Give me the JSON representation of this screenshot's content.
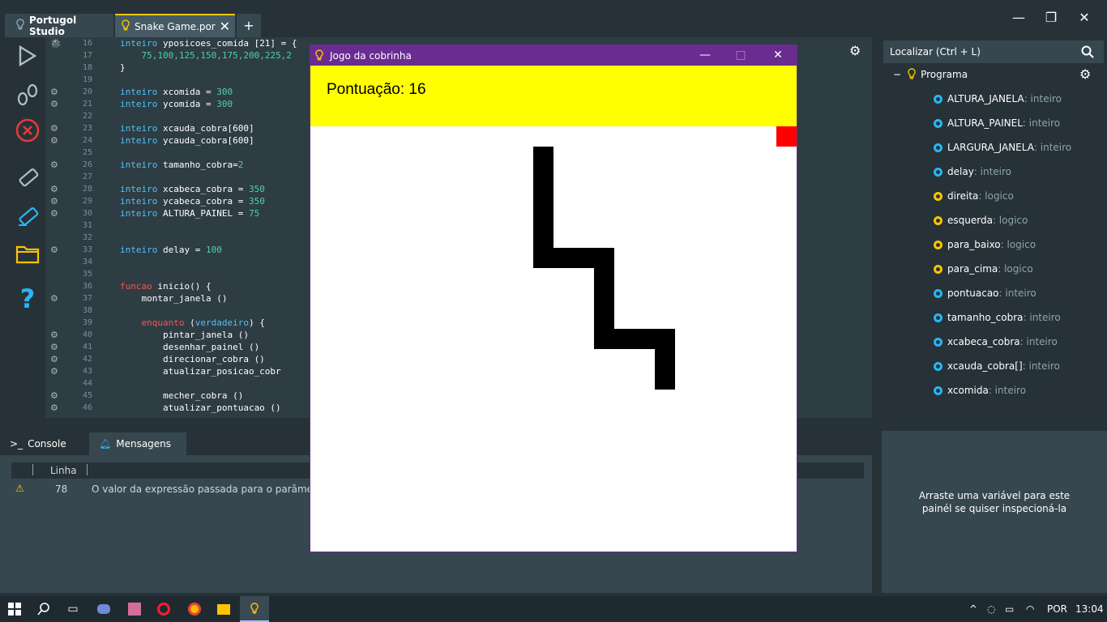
{
  "tabs": {
    "home": "Portugol Studio",
    "file": "Snake Game.por",
    "add": "+"
  },
  "window": {
    "minimize": "—",
    "maximize": "❐",
    "close": "✕"
  },
  "editor": {
    "lines": [
      {
        "n": "16",
        "code": [
          "inteiro yposicoes_comida [21] = {"
        ]
      },
      {
        "n": "17",
        "code": [
          "    75,100,125,150,175,200,225,2"
        ]
      },
      {
        "n": "18",
        "code": [
          "}"
        ]
      },
      {
        "n": "19",
        "code": [
          ""
        ]
      },
      {
        "n": "20",
        "code": [
          "inteiro xcomida = 300"
        ]
      },
      {
        "n": "21",
        "code": [
          "inteiro ycomida = 300"
        ]
      },
      {
        "n": "22",
        "code": [
          ""
        ]
      },
      {
        "n": "23",
        "code": [
          "inteiro xcauda_cobra[600]"
        ]
      },
      {
        "n": "24",
        "code": [
          "inteiro ycauda_cobra[600]"
        ]
      },
      {
        "n": "25",
        "code": [
          ""
        ]
      },
      {
        "n": "26",
        "code": [
          "inteiro tamanho_cobra=2"
        ]
      },
      {
        "n": "27",
        "code": [
          ""
        ]
      },
      {
        "n": "28",
        "code": [
          "inteiro xcabeca_cobra = 350"
        ]
      },
      {
        "n": "29",
        "code": [
          "inteiro ycabeca_cobra = 350"
        ]
      },
      {
        "n": "30",
        "code": [
          "inteiro ALTURA_PAINEL = 75"
        ]
      },
      {
        "n": "31",
        "code": [
          ""
        ]
      },
      {
        "n": "32",
        "code": [
          ""
        ]
      },
      {
        "n": "33",
        "code": [
          "inteiro delay = 100"
        ]
      },
      {
        "n": "34",
        "code": [
          ""
        ]
      },
      {
        "n": "35",
        "code": [
          ""
        ]
      },
      {
        "n": "36",
        "code": [
          "funcao inicio() {"
        ]
      },
      {
        "n": "37",
        "code": [
          "    montar_janela ()"
        ]
      },
      {
        "n": "38",
        "code": [
          ""
        ]
      },
      {
        "n": "39",
        "code": [
          "    enquanto (verdadeiro) {"
        ]
      },
      {
        "n": "40",
        "code": [
          "        pintar_janela ()"
        ]
      },
      {
        "n": "41",
        "code": [
          "        desenhar_painel ()"
        ]
      },
      {
        "n": "42",
        "code": [
          "        direcionar_cobra ()"
        ]
      },
      {
        "n": "43",
        "code": [
          "        atualizar_posicao_cobr"
        ]
      },
      {
        "n": "44",
        "code": [
          ""
        ]
      },
      {
        "n": "45",
        "code": [
          "        mecher_cobra ()"
        ]
      },
      {
        "n": "46",
        "code": [
          "        atualizar_pontuacao ()"
        ]
      }
    ]
  },
  "bottom": {
    "console_tab": "Console",
    "messages_tab": "Mensagens",
    "col_line": "Linha",
    "row_line": "78",
    "row_message": "O valor da expressão passada para o parâmetro \"t"
  },
  "right": {
    "search_placeholder": "Localizar (Ctrl + L)",
    "root": "Programa",
    "items": [
      {
        "name": "ALTURA_JANELA",
        "type": " : inteiro",
        "color": "blue"
      },
      {
        "name": "ALTURA_PAINEL",
        "type": " : inteiro",
        "color": "blue"
      },
      {
        "name": "LARGURA_JANELA",
        "type": " : inteiro",
        "color": "blue"
      },
      {
        "name": "delay",
        "type": " : inteiro",
        "color": "blue"
      },
      {
        "name": "direita",
        "type": " : logico",
        "color": "yellow"
      },
      {
        "name": "esquerda",
        "type": " : logico",
        "color": "yellow"
      },
      {
        "name": "para_baixo",
        "type": " : logico",
        "color": "yellow"
      },
      {
        "name": "para_cima",
        "type": " : logico",
        "color": "yellow"
      },
      {
        "name": "pontuacao",
        "type": " : inteiro",
        "color": "blue"
      },
      {
        "name": "tamanho_cobra",
        "type": " : inteiro",
        "color": "blue"
      },
      {
        "name": "xcabeca_cobra",
        "type": " : inteiro",
        "color": "blue"
      },
      {
        "name": "xcauda_cobra[]",
        "type": " : inteiro",
        "color": "blue"
      },
      {
        "name": "xcomida",
        "type": " : inteiro",
        "color": "blue"
      }
    ],
    "inspect_line1": "Arraste uma variável para este",
    "inspect_line2": "painél se quiser inspecioná-la"
  },
  "game": {
    "title": "Jogo da cobrinha",
    "score": "Pontuação: 16"
  },
  "taskbar": {
    "language": "POR",
    "clock": "13:04"
  },
  "colors": {
    "accent": "#ffc400",
    "game_title": "#6a2c91",
    "game_header": "#ffff00",
    "food": "#ff0000",
    "snake": "#000000"
  }
}
